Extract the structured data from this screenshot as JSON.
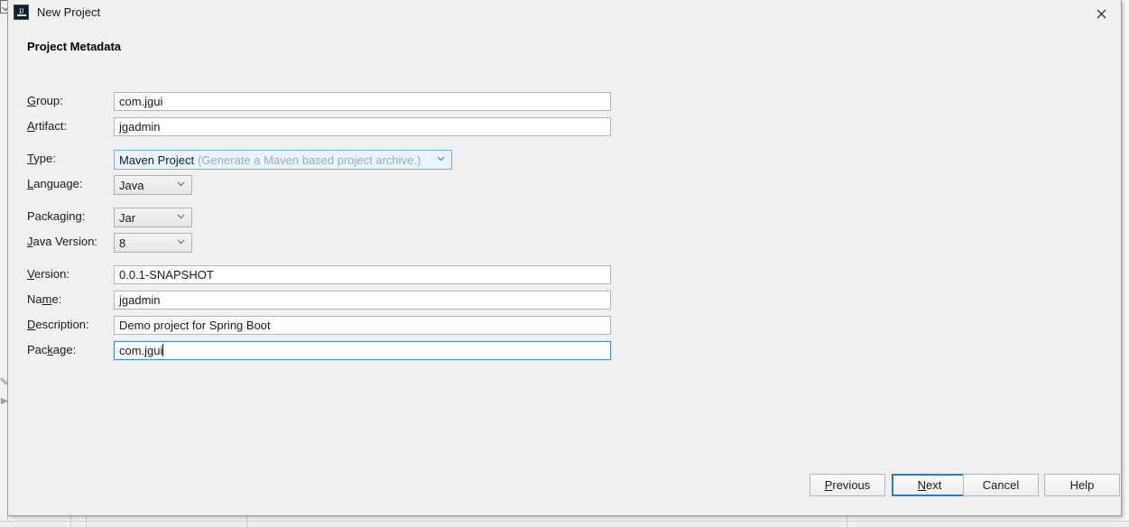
{
  "window": {
    "title": "New Project",
    "app_icon": "intellij-idea-icon",
    "icon_letters": "IJ",
    "close_label": "×"
  },
  "dialog": {
    "section_title": "Project Metadata"
  },
  "fields": [
    {
      "key": "group",
      "label_pre": "",
      "label_mn": "G",
      "label_post": "roup:",
      "type": "text",
      "value": "com.jgui",
      "focused": false
    },
    {
      "key": "artifact",
      "label_pre": "",
      "label_mn": "A",
      "label_post": "rtifact:",
      "type": "text",
      "value": "jgadmin",
      "focused": false
    },
    {
      "key": "type",
      "label_pre": "",
      "label_mn": "T",
      "label_post": "ype:",
      "type": "combo-wide",
      "value": "Maven Project",
      "hint": "(Generate a Maven based project archive.)",
      "focused": true
    },
    {
      "key": "language",
      "label_pre": "",
      "label_mn": "L",
      "label_post": "anguage:",
      "type": "combo-small",
      "value": "Java",
      "focused": false
    },
    {
      "key": "packaging",
      "label_pre": "Packa",
      "label_mn": "g",
      "label_post": "ing:",
      "type": "combo-small",
      "value": "Jar",
      "focused": false
    },
    {
      "key": "java-version",
      "label_pre": "",
      "label_mn": "J",
      "label_post": "ava Version:",
      "type": "combo-small",
      "value": "8",
      "focused": false
    },
    {
      "key": "version",
      "label_pre": "",
      "label_mn": "V",
      "label_post": "ersion:",
      "type": "text",
      "value": "0.0.1-SNAPSHOT",
      "focused": false
    },
    {
      "key": "name",
      "label_pre": "Na",
      "label_mn": "m",
      "label_post": "e:",
      "type": "text",
      "value": "jgadmin",
      "focused": false
    },
    {
      "key": "description",
      "label_pre": "",
      "label_mn": "D",
      "label_post": "escription:",
      "type": "text",
      "value": "Demo project for Spring Boot",
      "focused": false
    },
    {
      "key": "package",
      "label_pre": "Pac",
      "label_mn": "k",
      "label_post": "age:",
      "type": "text",
      "value": "com.jgui",
      "focused": true,
      "caret": true
    }
  ],
  "buttons": [
    {
      "key": "previous",
      "pre": "",
      "mn": "P",
      "post": "revious",
      "default": false
    },
    {
      "key": "next",
      "pre": "",
      "mn": "N",
      "post": "ext",
      "default": true
    },
    {
      "key": "cancel",
      "pre": "Cancel",
      "mn": "",
      "post": "",
      "default": false
    },
    {
      "key": "help",
      "pre": "Help",
      "mn": "",
      "post": "",
      "default": false
    }
  ],
  "colors": {
    "dialog_bg": "#f0f0f0",
    "focus_blue": "#2b7cbf",
    "combo_focus_bg": "#eaf3fa",
    "hint_gray": "#a8a8a8",
    "icon_navy": "#10223e"
  }
}
